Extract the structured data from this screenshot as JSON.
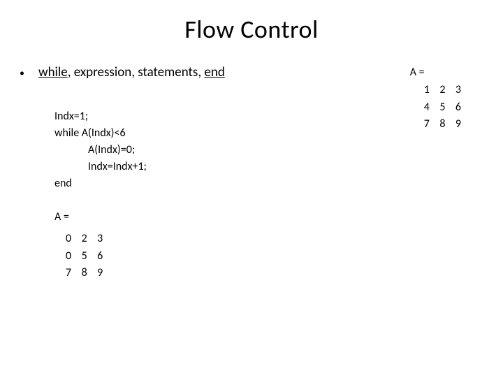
{
  "title": "Flow Control",
  "bullet": {
    "segments": {
      "kw_while": "while",
      "sep1": ", expression, statements, ",
      "kw_end": "end"
    }
  },
  "code": {
    "l1": "Indx=1;",
    "l2": "while A(Indx)<6",
    "l3": "A(Indx)=0;",
    "l4": "Indx=Indx+1;",
    "l5": "end"
  },
  "result": {
    "label": "A =",
    "r1": "0    2    3",
    "r2": "0    5    6",
    "r3": "7    8    9"
  },
  "input_matrix": {
    "label": "A =",
    "r1": "1    2    3",
    "r2": "4    5    6",
    "r3": "7    8    9"
  }
}
